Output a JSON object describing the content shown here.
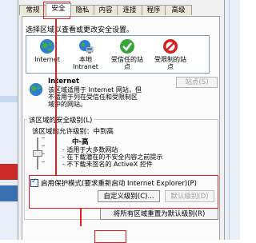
{
  "tabs": [
    "常规",
    "安全",
    "隐私",
    "内容",
    "连接",
    "程序",
    "高级"
  ],
  "active_tab": "安全",
  "zone_prompt": "选择区域以查看或更改安全设置。",
  "zones": [
    {
      "label": "Internet",
      "icon": "globe-icon"
    },
    {
      "label": "本地\nIntranet",
      "icon": "intranet-icon"
    },
    {
      "label": "受信任的站\n点",
      "icon": "trusted-check-icon"
    },
    {
      "label": "受限制的站\n点",
      "icon": "restricted-icon"
    }
  ],
  "zone_info": {
    "title": "Internet",
    "description": "该区域适用于 Internet 网站，但\n不适用于列在受信任和受限制区\n域中的网站。"
  },
  "sites_button": "站点(S)",
  "security_level_group": "该区域的安全级别(L)",
  "allowed_levels": "该区域的允许级别：中到高",
  "level_name": "中-高",
  "level_description": "- 适用于大多数网站\n- 在下载潜在的不安全内容之前提示\n- 不下载未签名的 ActiveX 控件",
  "protected_mode": {
    "label": "启用保护模式(要求重新启动 Internet Explorer)(P)",
    "checked": true
  },
  "custom_level_button": "自定义级别(C)...",
  "default_level_button": "默认级别(D)",
  "reset_all_button": "将所有区域重置为默认级别(R)",
  "colors": {
    "annotation_red": "#e02020",
    "dialog_bg": "#f0f0f0",
    "panel_bg": "#fbfbfb"
  }
}
